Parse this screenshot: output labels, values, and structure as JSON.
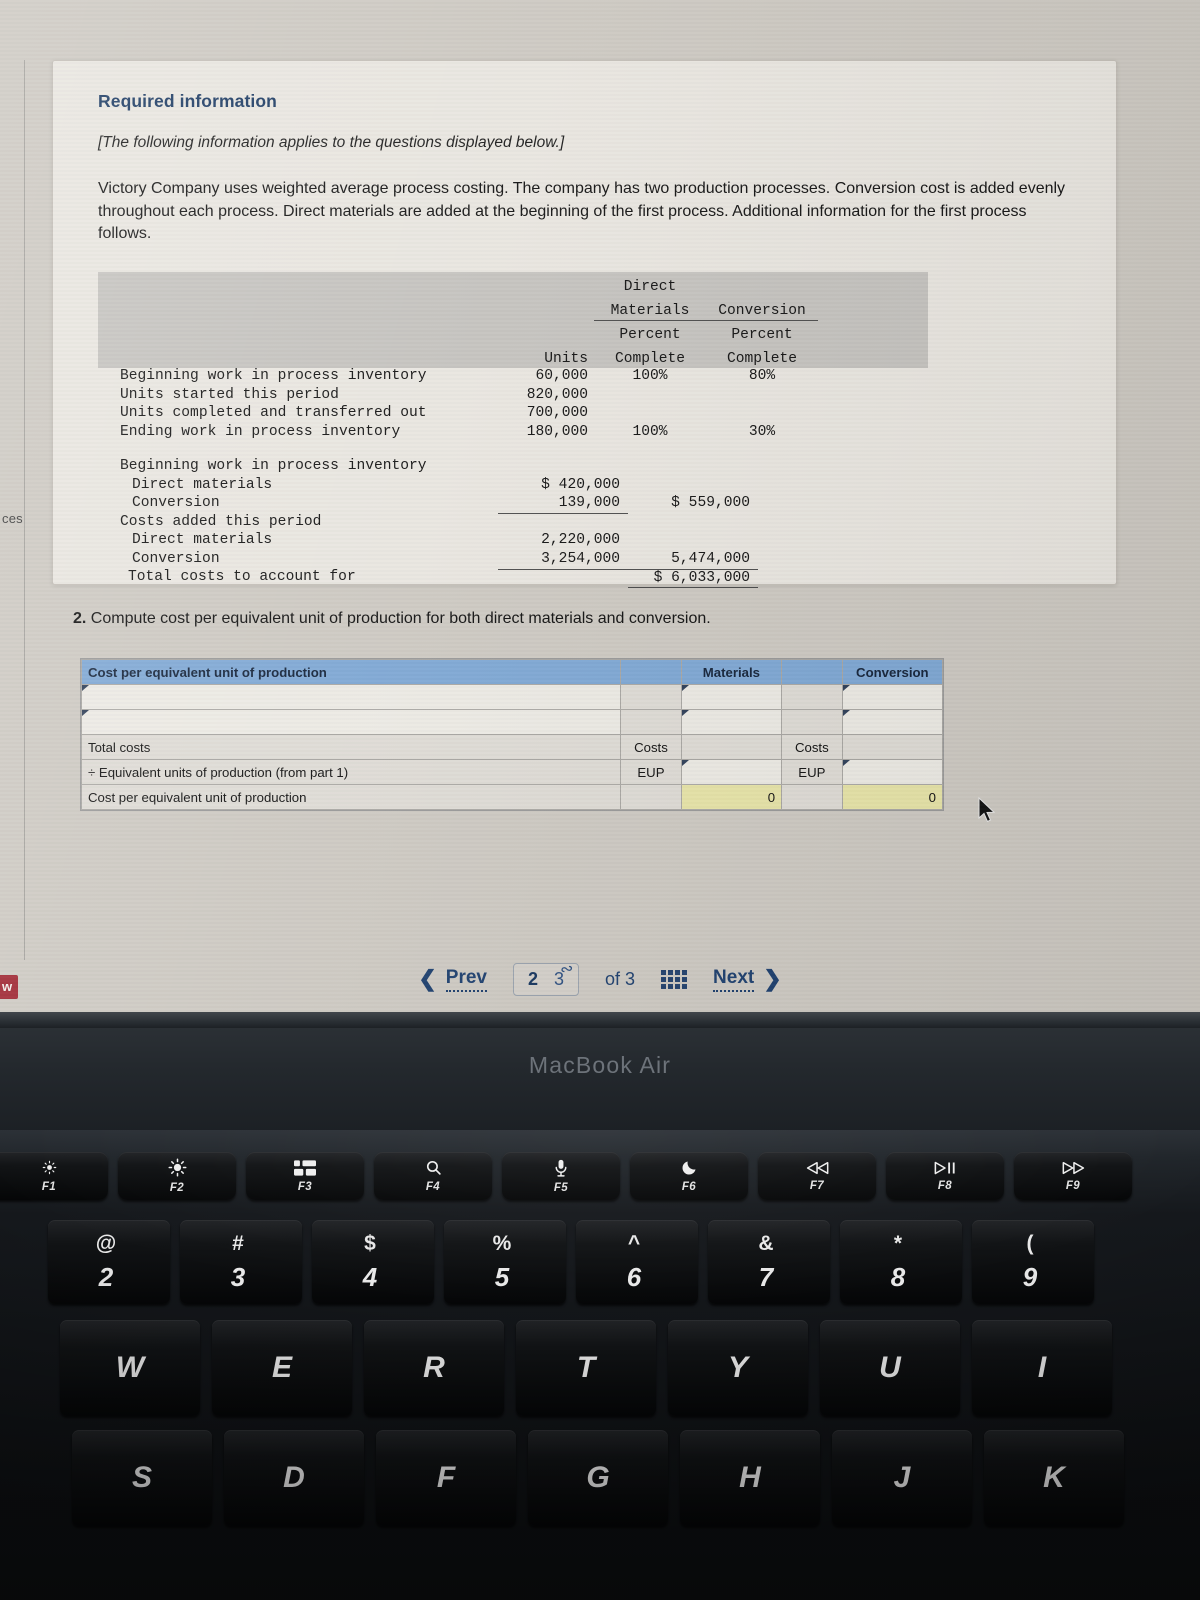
{
  "edge": {
    "left_partial_label": "ces",
    "left_badge_label": "w"
  },
  "card": {
    "required_title": "Required information",
    "applies_note": "[The following information applies to the questions displayed below.]",
    "intro": "Victory Company uses weighted average process costing. The company has two production processes. Conversion cost is added evenly throughout each process. Direct materials are added at the beginning of the first process. Additional information for the first process follows."
  },
  "facts_table": {
    "headers": {
      "dm_line1": "Direct",
      "dm_line2": "Materials",
      "conv": "Conversion",
      "units": "Units",
      "dm_pct1": "Percent",
      "dm_pct2": "Complete",
      "cv_pct1": "Percent",
      "cv_pct2": "Complete"
    },
    "unit_rows": [
      {
        "label": "Beginning work in process inventory",
        "units": "60,000",
        "dm": "100%",
        "conv": "80%"
      },
      {
        "label": "Units started this period",
        "units": "820,000",
        "dm": "",
        "conv": ""
      },
      {
        "label": "Units completed and transferred out",
        "units": "700,000",
        "dm": "",
        "conv": ""
      },
      {
        "label": "Ending work in process inventory",
        "units": "180,000",
        "dm": "100%",
        "conv": "30%"
      }
    ],
    "cost_rows": [
      {
        "label": "Beginning work in process inventory",
        "amount": "",
        "total": ""
      },
      {
        "label": "Direct materials",
        "amount": "$ 420,000",
        "total": ""
      },
      {
        "label": "Conversion",
        "amount": "139,000",
        "total": "$ 559,000"
      },
      {
        "label": "Costs added this period",
        "amount": "",
        "total": ""
      },
      {
        "label": "Direct materials",
        "amount": "2,220,000",
        "total": ""
      },
      {
        "label": "Conversion",
        "amount": "3,254,000",
        "total": "5,474,000"
      },
      {
        "label": "Total costs to account for",
        "amount": "",
        "total": "$ 6,033,000"
      }
    ]
  },
  "question": {
    "number": "2.",
    "text": "Compute cost per equivalent unit of production for both direct materials and conversion."
  },
  "answer_grid": {
    "header": {
      "title": "Cost per equivalent unit of production",
      "materials": "Materials",
      "conversion": "Conversion"
    },
    "rows": [
      {
        "label": "",
        "mat_lbl": "",
        "mat_val": "",
        "conv_lbl": "",
        "conv_val": ""
      },
      {
        "label": "",
        "mat_lbl": "",
        "mat_val": "",
        "conv_lbl": "",
        "conv_val": ""
      },
      {
        "label": "Total costs",
        "mat_lbl": "Costs",
        "mat_val": "",
        "conv_lbl": "Costs",
        "conv_val": ""
      },
      {
        "label": "÷ Equivalent units of production (from part 1)",
        "mat_lbl": "EUP",
        "mat_val": "",
        "conv_lbl": "EUP",
        "conv_val": ""
      },
      {
        "label": "Cost per equivalent unit of production",
        "mat_lbl": "",
        "mat_val": "0",
        "conv_lbl": "",
        "conv_val": "0"
      }
    ]
  },
  "pagination": {
    "prev": "Prev",
    "next": "Next",
    "current_page": "2",
    "secondary_page": "3",
    "of_label": "of",
    "total_pages": "3",
    "grid_icon": "grid-icon"
  },
  "laptop": {
    "brand": "MacBook Air",
    "function_keys": [
      {
        "label": "F1",
        "icon": "brightness-down-icon"
      },
      {
        "label": "F2",
        "icon": "brightness-up-icon"
      },
      {
        "label": "F3",
        "icon": "mission-control-icon"
      },
      {
        "label": "F4",
        "icon": "search-icon"
      },
      {
        "label": "F5",
        "icon": "dictation-microphone-icon"
      },
      {
        "label": "F6",
        "icon": "do-not-disturb-moon-icon"
      },
      {
        "label": "F7",
        "icon": "rewind-icon"
      },
      {
        "label": "F8",
        "icon": "play-pause-icon"
      },
      {
        "label": "F9",
        "icon": "fast-forward-icon"
      }
    ],
    "number_keys": [
      {
        "shift": "@",
        "digit": "2"
      },
      {
        "shift": "#",
        "digit": "3"
      },
      {
        "shift": "$",
        "digit": "4"
      },
      {
        "shift": "%",
        "digit": "5"
      },
      {
        "shift": "^",
        "digit": "6"
      },
      {
        "shift": "&",
        "digit": "7"
      },
      {
        "shift": "*",
        "digit": "8"
      },
      {
        "shift": "(",
        "digit": "9"
      }
    ],
    "letter_row_1": [
      "W",
      "E",
      "R",
      "T",
      "Y",
      "U",
      "I"
    ],
    "letter_row_2": [
      "S",
      "D",
      "F",
      "G",
      "H",
      "J",
      "K"
    ]
  },
  "colors": {
    "header_blue": "#7fa8d4",
    "calc_yellow": "#e7e4a8",
    "title_navy": "#1b3a63",
    "badge_red": "#9e2430"
  }
}
